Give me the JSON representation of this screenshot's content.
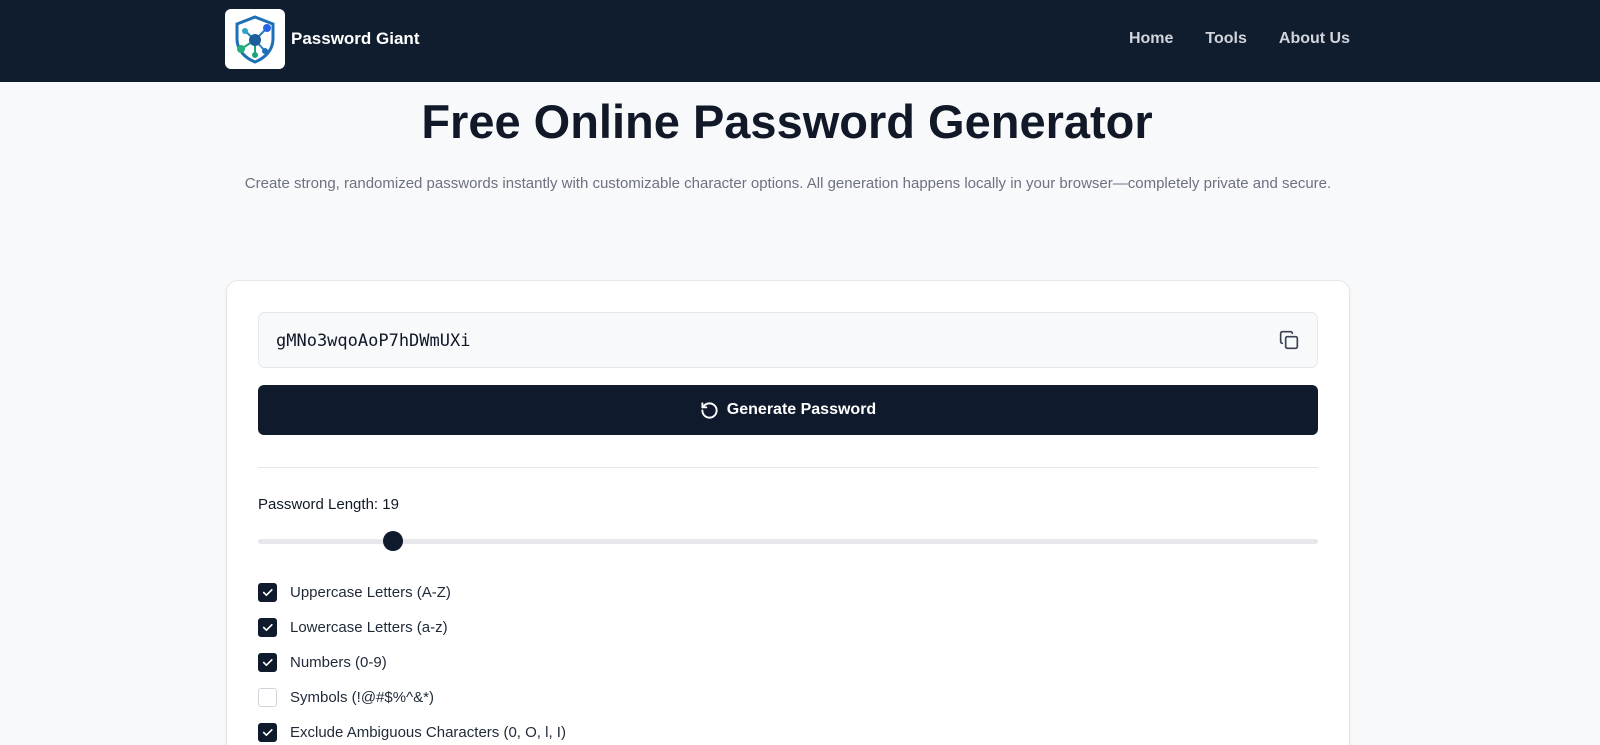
{
  "header": {
    "brand": "Password Giant",
    "nav": [
      "Home",
      "Tools",
      "About Us"
    ]
  },
  "hero": {
    "title": "Free Online Password Generator",
    "subtitle": "Create strong, randomized passwords instantly with customizable character options. All generation happens locally in your browser—completely private and secure."
  },
  "generator": {
    "password": "gMNo3wqoAoP7hDWmUXi",
    "generate_label": "Generate Password",
    "length_label": "Password Length: 19",
    "length_level": 0.127,
    "options": [
      {
        "label": "Uppercase Letters (A-Z)",
        "checked": true
      },
      {
        "label": "Lowercase Letters (a-z)",
        "checked": true
      },
      {
        "label": "Numbers (0-9)",
        "checked": true
      },
      {
        "label": "Symbols (!@#$%^&*)",
        "checked": false
      },
      {
        "label": "Exclude Ambiguous Characters (0, O, l, I)",
        "checked": true
      }
    ]
  },
  "colors": {
    "header_bg": "#101d2e",
    "button_bg": "#0f1b2c",
    "page_bg": "#f8f9fb"
  },
  "icons": {
    "logo": "shield-network-icon",
    "copy": "copy-icon",
    "regenerate": "rotate-ccw-icon",
    "check": "check-icon"
  }
}
